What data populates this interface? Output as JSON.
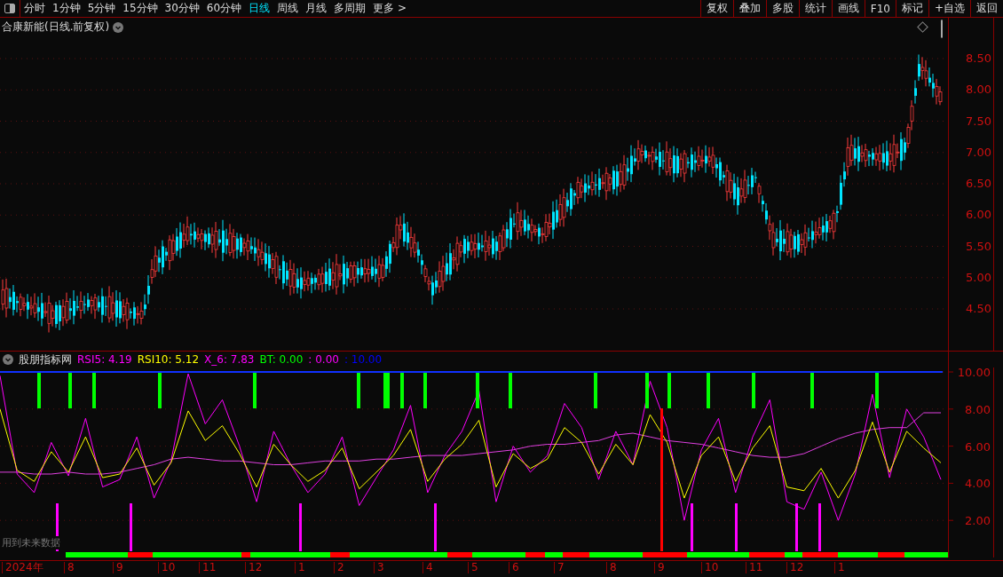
{
  "toolbar": {
    "periods": [
      {
        "label": "分时",
        "selected": false
      },
      {
        "label": "1分钟",
        "selected": false
      },
      {
        "label": "5分钟",
        "selected": false
      },
      {
        "label": "15分钟",
        "selected": false
      },
      {
        "label": "30分钟",
        "selected": false
      },
      {
        "label": "60分钟",
        "selected": false
      },
      {
        "label": "日线",
        "selected": true
      },
      {
        "label": "周线",
        "selected": false
      },
      {
        "label": "月线",
        "selected": false
      },
      {
        "label": "多周期",
        "selected": false
      }
    ],
    "more": "更多",
    "more_caret": ">",
    "buttons": [
      "复权",
      "叠加",
      "多股",
      "统计",
      "画线",
      "F10",
      "标记",
      "+自选",
      "返回"
    ]
  },
  "main_chart": {
    "title": "合康新能(日线.前复权)",
    "y_labels": [
      "8.50",
      "8.00",
      "7.50",
      "7.00",
      "6.50",
      "6.00",
      "5.50",
      "5.00",
      "4.50"
    ]
  },
  "indicator": {
    "name": "股朋指标网",
    "readouts": [
      {
        "text": "RSI5: 4.19",
        "color": "#ff00ff"
      },
      {
        "text": "RSI10: 5.12",
        "color": "#ffff00"
      },
      {
        "text": "X_6: 7.83",
        "color": "#ff00ff"
      },
      {
        "text": "BT: 0.00",
        "color": "#00ff00"
      },
      {
        "text": ": 0.00",
        "color": "#ff00ff"
      },
      {
        "text": ": 10.00",
        "color": "#0000ff"
      }
    ],
    "chart_data": {
      "type": "line",
      "ylim": [
        0,
        10.24
      ],
      "grid": true,
      "yticks": [
        {
          "value": 10,
          "label": "10.00"
        },
        {
          "value": 8,
          "label": "8.00"
        },
        {
          "value": 6,
          "label": "6.00"
        },
        {
          "value": 4,
          "label": "4.00"
        },
        {
          "value": 2,
          "label": "2.00"
        }
      ],
      "series": [
        {
          "color": "#e040e0",
          "values": [
            4.6,
            4.6,
            4.5,
            4.5,
            4.6,
            4.5,
            4.5,
            4.6,
            4.8,
            5.0,
            5.3,
            5.4,
            5.3,
            5.2,
            5.2,
            5.1,
            5.0,
            5.0,
            5.1,
            5.2,
            5.2,
            5.2,
            5.3,
            5.3,
            5.4,
            5.5,
            5.5,
            5.5,
            5.6,
            5.7,
            5.8,
            6.0,
            6.1,
            6.1,
            6.2,
            6.3,
            6.6,
            6.7,
            6.5,
            6.3,
            6.2,
            6.1,
            5.9,
            5.7,
            5.5,
            5.4,
            5.4,
            5.6,
            6.0,
            6.4,
            6.7,
            6.9,
            7.0,
            7.0,
            7.8,
            7.8
          ]
        },
        {
          "color": "#ff00ff",
          "values": [
            9.8,
            4.5,
            3.5,
            6.2,
            4.4,
            7.5,
            3.8,
            4.2,
            6.5,
            3.2,
            5.2,
            9.9,
            7.2,
            8.5,
            6.0,
            3.0,
            6.8,
            5.0,
            3.5,
            4.5,
            6.5,
            2.8,
            4.3,
            5.8,
            8.2,
            3.5,
            5.5,
            6.8,
            9.0,
            3.0,
            6.0,
            4.6,
            5.5,
            8.3,
            7.0,
            4.2,
            6.8,
            5.0,
            9.5,
            7.0,
            2.0,
            5.8,
            7.5,
            3.5,
            6.5,
            8.5,
            3.0,
            2.6,
            4.6,
            2.0,
            4.5,
            8.8,
            4.3,
            8.0,
            6.5,
            4.2
          ]
        },
        {
          "color": "#ffff00",
          "values": [
            8.0,
            4.7,
            4.1,
            5.7,
            4.6,
            6.5,
            4.3,
            4.5,
            5.9,
            3.9,
            5.1,
            7.9,
            6.3,
            7.1,
            5.6,
            3.8,
            6.1,
            5.0,
            4.1,
            4.7,
            5.9,
            3.7,
            4.6,
            5.5,
            6.9,
            4.1,
            5.3,
            6.1,
            7.4,
            3.8,
            5.6,
            4.8,
            5.3,
            7.0,
            6.2,
            4.5,
            6.1,
            5.0,
            7.7,
            6.2,
            3.2,
            5.5,
            6.5,
            4.1,
            5.9,
            7.1,
            3.8,
            3.6,
            4.8,
            3.2,
            4.7,
            7.3,
            4.6,
            6.8,
            5.9,
            5.1
          ]
        }
      ]
    },
    "note": "用到未来数据"
  },
  "time_axis": {
    "labels": [
      "2024年",
      "8",
      "9",
      "10",
      "11",
      "12",
      "1",
      "2",
      "3",
      "4",
      "5",
      "6",
      "7",
      "8",
      "9",
      "10",
      "11",
      "12",
      "1"
    ]
  }
}
